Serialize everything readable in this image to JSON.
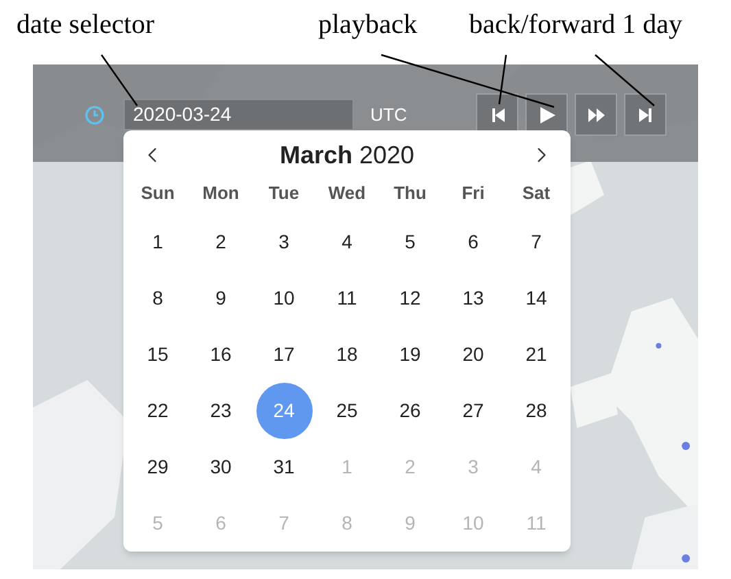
{
  "annotations": [
    {
      "text": "date selector"
    },
    {
      "text": "playback"
    },
    {
      "text": "back/forward 1 day"
    }
  ],
  "toolbar": {
    "date_value": "2020-03-24",
    "timezone": "UTC",
    "buttons": [
      {
        "kind": "step-back"
      },
      {
        "kind": "play"
      },
      {
        "kind": "fast-forward"
      },
      {
        "kind": "step-forward"
      }
    ]
  },
  "calendar": {
    "month": "March",
    "year": "2020",
    "weekdays": [
      "Sun",
      "Mon",
      "Tue",
      "Wed",
      "Thu",
      "Fri",
      "Sat"
    ],
    "weeks": [
      [
        {
          "day": "1",
          "in_month": true,
          "selected": false
        },
        {
          "day": "2",
          "in_month": true,
          "selected": false
        },
        {
          "day": "3",
          "in_month": true,
          "selected": false
        },
        {
          "day": "4",
          "in_month": true,
          "selected": false
        },
        {
          "day": "5",
          "in_month": true,
          "selected": false
        },
        {
          "day": "6",
          "in_month": true,
          "selected": false
        },
        {
          "day": "7",
          "in_month": true,
          "selected": false
        }
      ],
      [
        {
          "day": "8",
          "in_month": true,
          "selected": false
        },
        {
          "day": "9",
          "in_month": true,
          "selected": false
        },
        {
          "day": "10",
          "in_month": true,
          "selected": false
        },
        {
          "day": "11",
          "in_month": true,
          "selected": false
        },
        {
          "day": "12",
          "in_month": true,
          "selected": false
        },
        {
          "day": "13",
          "in_month": true,
          "selected": false
        },
        {
          "day": "14",
          "in_month": true,
          "selected": false
        }
      ],
      [
        {
          "day": "15",
          "in_month": true,
          "selected": false
        },
        {
          "day": "16",
          "in_month": true,
          "selected": false
        },
        {
          "day": "17",
          "in_month": true,
          "selected": false
        },
        {
          "day": "18",
          "in_month": true,
          "selected": false
        },
        {
          "day": "19",
          "in_month": true,
          "selected": false
        },
        {
          "day": "20",
          "in_month": true,
          "selected": false
        },
        {
          "day": "21",
          "in_month": true,
          "selected": false
        }
      ],
      [
        {
          "day": "22",
          "in_month": true,
          "selected": false
        },
        {
          "day": "23",
          "in_month": true,
          "selected": false
        },
        {
          "day": "24",
          "in_month": true,
          "selected": true
        },
        {
          "day": "25",
          "in_month": true,
          "selected": false
        },
        {
          "day": "26",
          "in_month": true,
          "selected": false
        },
        {
          "day": "27",
          "in_month": true,
          "selected": false
        },
        {
          "day": "28",
          "in_month": true,
          "selected": false
        }
      ],
      [
        {
          "day": "29",
          "in_month": true,
          "selected": false
        },
        {
          "day": "30",
          "in_month": true,
          "selected": false
        },
        {
          "day": "31",
          "in_month": true,
          "selected": false
        },
        {
          "day": "1",
          "in_month": false,
          "selected": false
        },
        {
          "day": "2",
          "in_month": false,
          "selected": false
        },
        {
          "day": "3",
          "in_month": false,
          "selected": false
        },
        {
          "day": "4",
          "in_month": false,
          "selected": false
        }
      ],
      [
        {
          "day": "5",
          "in_month": false,
          "selected": false
        },
        {
          "day": "6",
          "in_month": false,
          "selected": false
        },
        {
          "day": "7",
          "in_month": false,
          "selected": false
        },
        {
          "day": "8",
          "in_month": false,
          "selected": false
        },
        {
          "day": "9",
          "in_month": false,
          "selected": false
        },
        {
          "day": "10",
          "in_month": false,
          "selected": false
        },
        {
          "day": "11",
          "in_month": false,
          "selected": false
        }
      ]
    ]
  }
}
